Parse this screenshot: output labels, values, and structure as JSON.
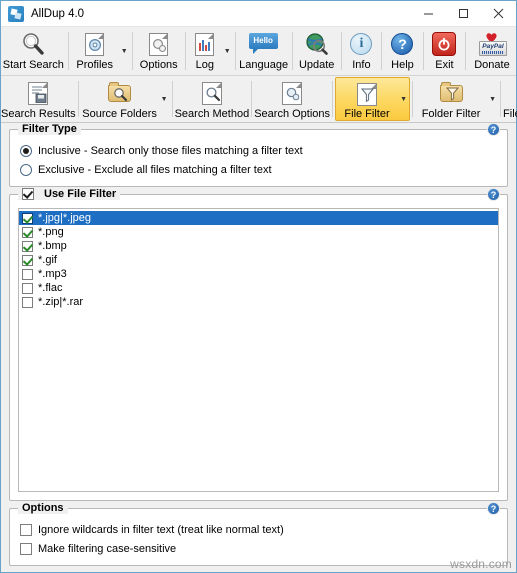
{
  "window": {
    "title": "AllDup 4.0",
    "app_icon": "alldup-logo-icon",
    "controls": {
      "minimize": "minimize-icon",
      "maximize": "maximize-icon",
      "close": "close-icon"
    }
  },
  "toolbar_primary": [
    {
      "label": "Start Search",
      "icon": "magnifier-icon",
      "dropdown": false
    },
    {
      "label": "Profiles",
      "icon": "profiles-document-gear-icon",
      "dropdown": true
    },
    {
      "label": "Options",
      "icon": "options-gears-icon",
      "dropdown": false
    },
    {
      "label": "Log",
      "icon": "log-chart-document-icon",
      "dropdown": true
    },
    {
      "label": "Language",
      "icon": "hello-speech-bubble-icon",
      "dropdown": false,
      "badge": "Hello"
    },
    {
      "label": "Update",
      "icon": "globe-magnifier-icon",
      "dropdown": false
    },
    {
      "label": "Info",
      "icon": "info-circle-icon",
      "dropdown": false,
      "glyph": "i"
    },
    {
      "label": "Help",
      "icon": "question-circle-icon",
      "dropdown": false,
      "glyph": "?"
    },
    {
      "label": "Exit",
      "icon": "power-off-icon",
      "dropdown": false
    },
    {
      "label": "Donate",
      "icon": "paypal-heart-icon",
      "dropdown": false,
      "badge": "PayPal"
    }
  ],
  "toolbar_secondary": [
    {
      "label": "Search Results",
      "icon": "document-save-icon",
      "dropdown": false,
      "active": false
    },
    {
      "label": "Source Folders",
      "icon": "folder-magnifier-icon",
      "dropdown": true,
      "active": false
    },
    {
      "label": "Search Method",
      "icon": "document-magnifier-icon",
      "dropdown": false,
      "active": false
    },
    {
      "label": "Search Options",
      "icon": "document-gears-icon",
      "dropdown": false,
      "active": false
    },
    {
      "label": "File Filter",
      "icon": "document-funnel-icon",
      "dropdown": true,
      "active": true
    },
    {
      "label": "Folder Filter",
      "icon": "folder-funnel-icon",
      "dropdown": true,
      "active": false
    },
    {
      "label": "File Preview",
      "icon": "preview-magnifier-icon",
      "dropdown": false,
      "active": false
    }
  ],
  "filter_type": {
    "title": "Filter Type",
    "help": "?",
    "selected": "inclusive",
    "options": [
      {
        "id": "inclusive",
        "label": "Inclusive - Search only those files matching a filter text",
        "selected": true
      },
      {
        "id": "exclusive",
        "label": "Exclusive - Exclude all files matching a filter text",
        "selected": false
      }
    ]
  },
  "use_file_filter": {
    "title": "Use File Filter",
    "checked": true,
    "help": "?",
    "items": [
      {
        "text": "*.jpg|*.jpeg",
        "checked": true,
        "selected": true
      },
      {
        "text": "*.png",
        "checked": true,
        "selected": false
      },
      {
        "text": "*.bmp",
        "checked": true,
        "selected": false
      },
      {
        "text": "*.gif",
        "checked": true,
        "selected": false
      },
      {
        "text": "*.mp3",
        "checked": false,
        "selected": false
      },
      {
        "text": "*.flac",
        "checked": false,
        "selected": false
      },
      {
        "text": "*.zip|*.rar",
        "checked": false,
        "selected": false
      }
    ]
  },
  "options": {
    "title": "Options",
    "help": "?",
    "items": [
      {
        "label": "Ignore wildcards in filter text (treat like normal text)",
        "checked": false
      },
      {
        "label": "Make filtering case-sensitive",
        "checked": false
      }
    ]
  },
  "watermark": "wsxdn.com",
  "colors": {
    "accent": "#1e6fc4",
    "active_tab": "#fcd964",
    "window_border": "#6aa3c8",
    "help_blue": "#1f5fa8",
    "check_green": "#2b8a2b"
  }
}
